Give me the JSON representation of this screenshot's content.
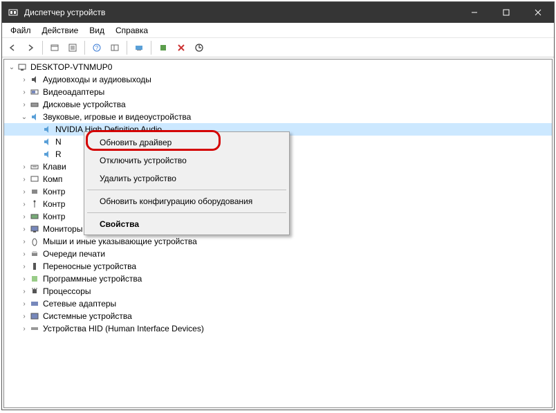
{
  "titlebar": {
    "title": "Диспетчер устройств"
  },
  "menubar": {
    "file": "Файл",
    "action": "Действие",
    "view": "Вид",
    "help": "Справка"
  },
  "tree": {
    "root": "DESKTOP-VTNMUP0",
    "cat_audio_io": "Аудиовходы и аудиовыходы",
    "cat_video": "Видеоадаптеры",
    "cat_disk": "Дисковые устройства",
    "cat_sound": "Звуковые, игровые и видеоустройства",
    "dev_nvidia": "NVIDIA High Definition Audio",
    "dev_n_cut": "N",
    "dev_r_cut": "R",
    "cat_keyboard": "Клави",
    "cat_computer": "Комп",
    "cat_controllers1": "Контр",
    "cat_controllers2": "Контр",
    "cat_controllers3": "Контр",
    "cat_monitors": "Мониторы",
    "cat_mice": "Мыши и иные указывающие устройства",
    "cat_printq": "Очереди печати",
    "cat_portable": "Переносные устройства",
    "cat_software": "Программные устройства",
    "cat_processors": "Процессоры",
    "cat_network": "Сетевые адаптеры",
    "cat_system": "Системные устройства",
    "cat_hid": "Устройства HID (Human Interface Devices)"
  },
  "context": {
    "update": "Обновить драйвер",
    "disable": "Отключить устройство",
    "uninstall": "Удалить устройство",
    "scan": "Обновить конфигурацию оборудования",
    "properties": "Свойства"
  }
}
